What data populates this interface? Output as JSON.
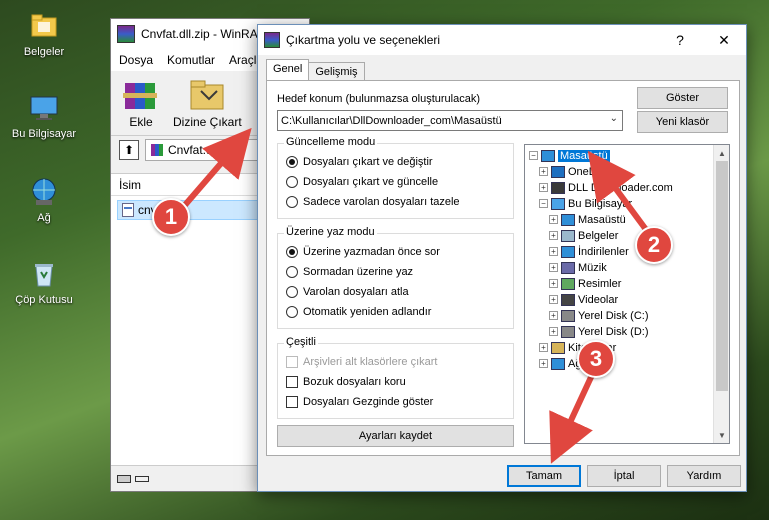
{
  "desktop": {
    "icons": [
      {
        "label": "Belgeler",
        "icon": "documents-folder-icon"
      },
      {
        "label": "Bu Bilgisayar",
        "icon": "this-pc-icon"
      },
      {
        "label": "Ağ",
        "icon": "network-icon"
      },
      {
        "label": "Çöp Kutusu",
        "icon": "recycle-bin-icon"
      }
    ]
  },
  "winrar": {
    "title": "Cnvfat.dll.zip - WinRAR",
    "menu": [
      "Dosya",
      "Komutlar",
      "Araçlar"
    ],
    "toolbar": {
      "add": "Ekle",
      "extract_to": "Dizine Çıkart"
    },
    "path": "Cnvfat.dll.zip",
    "column_name": "İsim",
    "file_row": "cnvfat.dll"
  },
  "dialog": {
    "title": "Çıkartma yolu ve seçenekleri",
    "help_glyph": "?",
    "close_glyph": "✕",
    "tabs": [
      "Genel",
      "Gelişmiş"
    ],
    "dest_label": "Hedef konum (bulunmazsa oluşturulacak)",
    "dest_value": "C:\\Kullanıcılar\\DllDownloader_com\\Masaüstü",
    "show_button": "Göster",
    "new_folder_button": "Yeni klasör",
    "update_mode": {
      "title": "Güncelleme modu",
      "options": [
        "Dosyaları çıkart ve değiştir",
        "Dosyaları çıkart ve güncelle",
        "Sadece varolan dosyaları tazele"
      ],
      "selected": 0
    },
    "overwrite_mode": {
      "title": "Üzerine yaz modu",
      "options": [
        "Üzerine yazmadan önce sor",
        "Sormadan üzerine yaz",
        "Varolan dosyaları atla",
        "Otomatik yeniden adlandır"
      ],
      "selected": 0
    },
    "misc": {
      "title": "Çeşitli",
      "options": [
        "Arşivleri alt klasörlere çıkart",
        "Bozuk dosyaları koru",
        "Dosyaları Gezginde göster"
      ],
      "disabled": [
        true,
        false,
        false
      ]
    },
    "save_settings": "Ayarları kaydet",
    "tree": [
      {
        "label": "Masaüstü",
        "level": 0,
        "expander": "−",
        "icon": "desktop-icon",
        "selected": true
      },
      {
        "label": "OneDrive",
        "level": 1,
        "expander": "+",
        "icon": "cloud-icon"
      },
      {
        "label": "DLL Downloader.com",
        "level": 1,
        "expander": "+",
        "icon": "user-icon"
      },
      {
        "label": "Bu Bilgisayar",
        "level": 1,
        "expander": "−",
        "icon": "computer-icon"
      },
      {
        "label": "Masaüstü",
        "level": 2,
        "expander": "+",
        "icon": "desktop-icon"
      },
      {
        "label": "Belgeler",
        "level": 2,
        "expander": "+",
        "icon": "documents-icon"
      },
      {
        "label": "İndirilenler",
        "level": 2,
        "expander": "+",
        "icon": "downloads-icon"
      },
      {
        "label": "Müzik",
        "level": 2,
        "expander": "+",
        "icon": "music-icon"
      },
      {
        "label": "Resimler",
        "level": 2,
        "expander": "+",
        "icon": "pictures-icon"
      },
      {
        "label": "Videolar",
        "level": 2,
        "expander": "+",
        "icon": "videos-icon"
      },
      {
        "label": "Yerel Disk (C:)",
        "level": 2,
        "expander": "+",
        "icon": "drive-icon"
      },
      {
        "label": "Yerel Disk (D:)",
        "level": 2,
        "expander": "+",
        "icon": "drive-icon"
      },
      {
        "label": "Kitaplıklar",
        "level": 1,
        "expander": "+",
        "icon": "libraries-icon"
      },
      {
        "label": "Ağ",
        "level": 1,
        "expander": "+",
        "icon": "network-icon"
      }
    ],
    "ok": "Tamam",
    "cancel": "İptal",
    "help": "Yardım"
  },
  "annotations": [
    "1",
    "2",
    "3"
  ],
  "colors": {
    "accent": "#0078d7",
    "badge": "#e0473f",
    "arrow": "#e0473f"
  }
}
